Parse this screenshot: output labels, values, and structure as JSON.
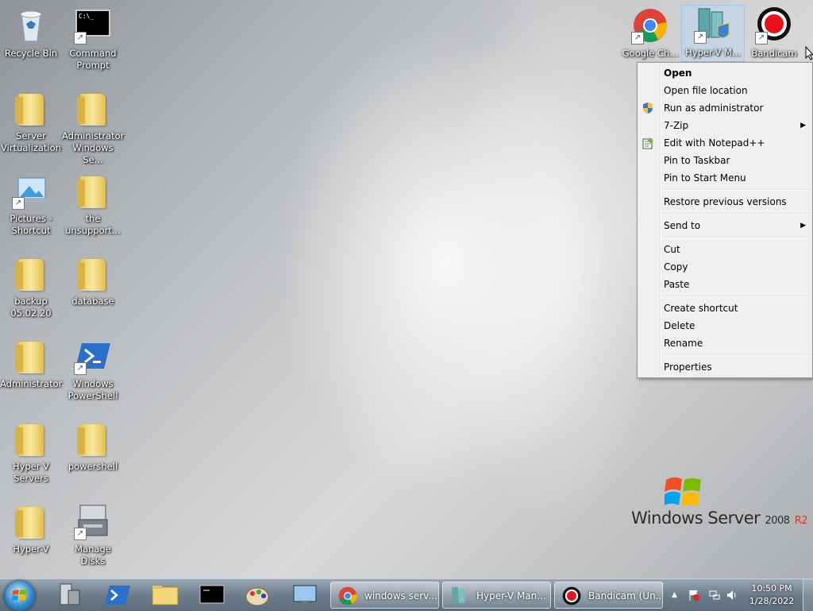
{
  "desktop_icons": [
    {
      "label": "Recycle Bin"
    },
    {
      "label": "Command Prompt"
    },
    {
      "label": "Server Virtualization"
    },
    {
      "label": "Administrator Windows Se..."
    },
    {
      "label": "Pictures - Shortcut"
    },
    {
      "label": "the unsupport..."
    },
    {
      "label": "backup 05.02.20"
    },
    {
      "label": "database"
    },
    {
      "label": "Administrator"
    },
    {
      "label": "Windows PowerShell"
    },
    {
      "label": "Hyper V Servers"
    },
    {
      "label": "powershell"
    },
    {
      "label": "Hyper-V"
    },
    {
      "label": "Manage Disks"
    },
    {
      "label": "Google Ch..."
    },
    {
      "label": "Hyper-V M..."
    },
    {
      "label": "Bandicam"
    }
  ],
  "cmd_icon_text": "C:\\_",
  "context_menu": {
    "items": [
      {
        "label": "Open"
      },
      {
        "label": "Open file location"
      },
      {
        "label": "Run as administrator"
      },
      {
        "label": "7-Zip"
      },
      {
        "label": "Edit with Notepad++"
      },
      {
        "label": "Pin to Taskbar"
      },
      {
        "label": "Pin to Start Menu"
      },
      {
        "label": "Restore previous versions"
      },
      {
        "label": "Send to"
      },
      {
        "label": "Cut"
      },
      {
        "label": "Copy"
      },
      {
        "label": "Paste"
      },
      {
        "label": "Create shortcut"
      },
      {
        "label": "Delete"
      },
      {
        "label": "Rename"
      },
      {
        "label": "Properties"
      }
    ]
  },
  "logo": {
    "windows": "Windows Server",
    "year": "2008",
    "r2": "R2"
  },
  "taskbar": {
    "buttons": [
      {
        "label": "windows serv..."
      },
      {
        "label": "Hyper-V Man..."
      },
      {
        "label": "Bandicam (Un..."
      }
    ],
    "clock": {
      "time": "10:50 PM",
      "date": "1/28/2022"
    }
  },
  "colors": {
    "menu_bg": "#f0f0f0",
    "taskbar": "#6d7c8a"
  }
}
